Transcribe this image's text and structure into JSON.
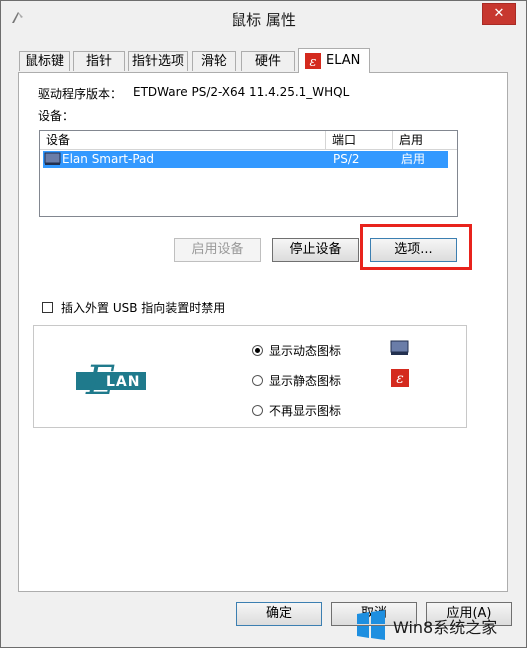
{
  "window": {
    "title": "鼠标 属性"
  },
  "tabs": [
    {
      "label": "鼠标键"
    },
    {
      "label": "指针"
    },
    {
      "label": "指针选项"
    },
    {
      "label": "滑轮"
    },
    {
      "label": "硬件"
    },
    {
      "label": "ELAN",
      "active": true
    }
  ],
  "panel": {
    "driver_version_label": "驱动程序版本：",
    "driver_version_value": "ETDWare PS/2-X64 11.4.25.1_WHQL",
    "devices_label": "设备："
  },
  "device_table": {
    "columns": [
      "设备",
      "端口",
      "启用"
    ],
    "rows": [
      {
        "device": "Elan Smart-Pad",
        "port": "PS/2",
        "enabled": "启用",
        "selected": true
      }
    ]
  },
  "device_buttons": {
    "enable": "启用设备",
    "stop": "停止设备",
    "options": "选项..."
  },
  "usb_disable_label": "插入外置 USB 指向装置时禁用",
  "icon_options": {
    "logo_text": "LAN",
    "dynamic": "显示动态图标",
    "static": "显示静态图标",
    "none": "不再显示图标",
    "selected": "dynamic"
  },
  "footer_buttons": {
    "ok": "确定",
    "cancel": "取消",
    "apply": "应用(A)"
  },
  "watermark": {
    "text": "Win8系统之家"
  },
  "colors": {
    "selection": "#3399ff",
    "highlight_box": "#e8231c",
    "elan_logo": "#1f7a8c",
    "static_icon": "#d42a1e"
  }
}
